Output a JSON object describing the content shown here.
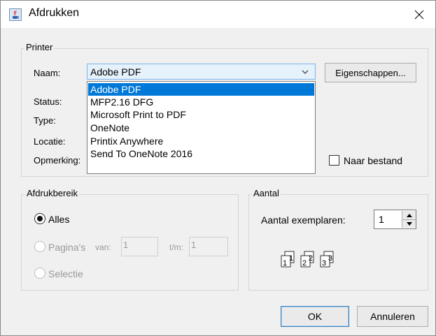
{
  "window": {
    "title": "Afdrukken",
    "icons": {
      "app": "java-cup-icon",
      "close": "close-icon"
    }
  },
  "printer": {
    "group_title": "Printer",
    "name_label": "Naam:",
    "selected": "Adobe PDF",
    "options": [
      "Adobe PDF",
      "MFP2.16 DFG",
      "Microsoft Print to PDF",
      "OneNote",
      "Printix Anywhere",
      "Send To OneNote 2016"
    ],
    "properties_button": "Eigenschappen...",
    "status_label": "Status:",
    "type_label": "Type:",
    "location_label": "Locatie:",
    "comment_label": "Opmerking:",
    "print_to_file_label": "Naar bestand",
    "print_to_file_checked": false
  },
  "range": {
    "group_title": "Afdrukbereik",
    "all_label": "Alles",
    "all_selected": true,
    "pages_label": "Pagina's",
    "from_label": "van:",
    "from_value": "1",
    "to_label": "t/m:",
    "to_value": "1",
    "selection_label": "Selectie"
  },
  "copies": {
    "group_title": "Aantal",
    "count_label": "Aantal exemplaren:",
    "count_value": "1",
    "collate_icon": "collate-copies-icon"
  },
  "buttons": {
    "ok": "OK",
    "cancel": "Annuleren"
  },
  "colors": {
    "selection": "#0078d7",
    "combo_bg": "#e5f1fb",
    "dialog_bg": "#f0f0f0"
  }
}
